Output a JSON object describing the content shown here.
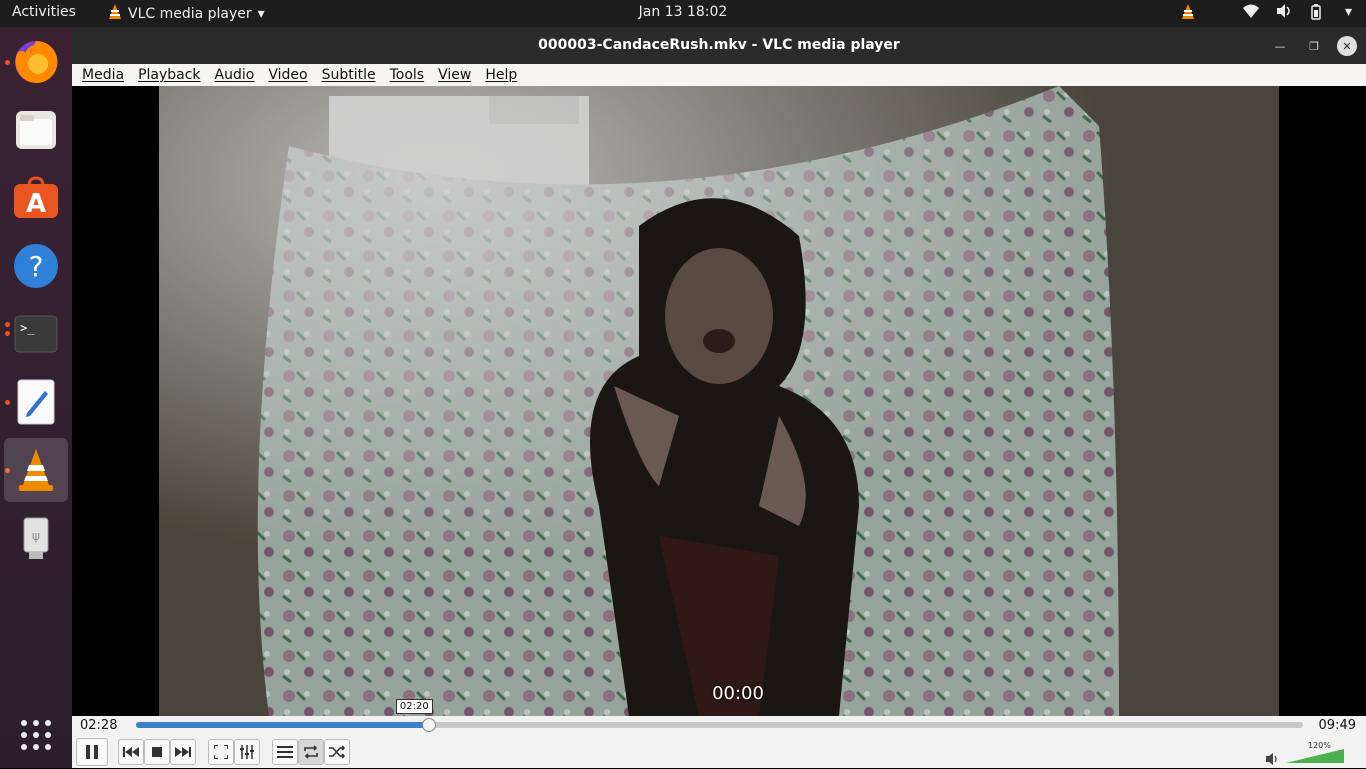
{
  "topbar": {
    "activities": "Activities",
    "app_name": "VLC media player",
    "clock": "Jan 13  18:02"
  },
  "dock": {
    "items": [
      {
        "name": "firefox",
        "running": true
      },
      {
        "name": "files",
        "running": false
      },
      {
        "name": "software",
        "running": false
      },
      {
        "name": "help",
        "running": false
      },
      {
        "name": "terminal",
        "running": true
      },
      {
        "name": "text-editor",
        "running": true
      },
      {
        "name": "vlc",
        "running": true,
        "active": true
      },
      {
        "name": "usb-drive",
        "running": false
      }
    ]
  },
  "window": {
    "title": "000003-CandaceRush.mkv - VLC media player",
    "menu": [
      "Media",
      "Playback",
      "Audio",
      "Video",
      "Subtitle",
      "Tools",
      "View",
      "Help"
    ]
  },
  "player": {
    "osd_time": "00:00",
    "elapsed": "02:28",
    "total": "09:49",
    "progress_fraction": 0.251,
    "hover_tooltip": "02:20",
    "volume_label": "120%",
    "volume_fraction": 1.0
  },
  "colors": {
    "accent": "#e95420",
    "progress": "#3d7fc9",
    "volume_green": "#4caf50"
  }
}
